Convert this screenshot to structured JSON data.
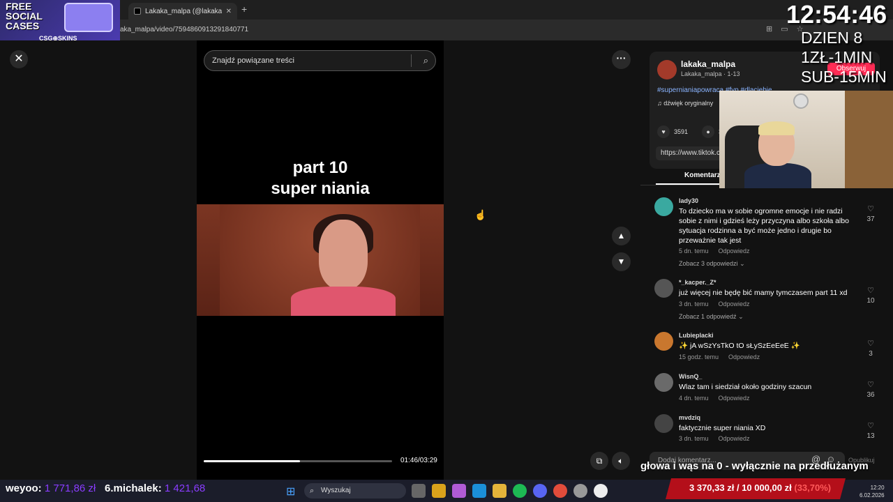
{
  "browser": {
    "tab_title": "Lakaka_malpa (@lakaka_ma",
    "new_tab": "+",
    "url": "aka_malpa/video/7594860913291840771"
  },
  "promo": {
    "line1": "FREE",
    "line2": "SOCIAL",
    "line3": "CASES",
    "brand": "CSG⊕SKINS"
  },
  "video": {
    "close": "✕",
    "search_placeholder": "Znajdź powiązane treści",
    "caption_line1": "part 10",
    "caption_line2": "super niania",
    "time": "01:46/03:29",
    "progress": 0.51
  },
  "post": {
    "username": "lakaka_malpa",
    "subline": "Lakaka_malpa · 1-13",
    "follow": "Obserwuj",
    "tags": "#supernianiapowraca #fyp #dlaciebie",
    "sound": "dźwięk oryginalny",
    "likes": "3591",
    "comments_count": "36",
    "link": "https://www.tiktok.c",
    "tab_comments": "Komentarze"
  },
  "comments": [
    {
      "user": "lady30",
      "text": "To dziecko ma w sobie ogromne emocje i nie radzi sobie z nimi i gdzieś leży przyczyna albo szkoła albo sytuacja rodzinna a być może jedno i drugie bo przeważnie tak jest",
      "time": "5 dn. temu",
      "reply": "Odpowiedz",
      "replies": "Zobacz 3 odpowiedzi",
      "likes": "37",
      "color": "#3aa9a0"
    },
    {
      "user": "*_kacper._Z*",
      "text": "już więcej nie będę bić mamy tymczasem part 11 xd",
      "time": "3 dn. temu",
      "reply": "Odpowiedz",
      "replies": "Zobacz 1 odpowiedź",
      "likes": "10",
      "color": "#555"
    },
    {
      "user": "Lubieplacki",
      "text": "✨ jA wSzYsTkO tO sŁySzEeEeE ✨",
      "time": "15 godz. temu",
      "reply": "Odpowiedz",
      "replies": "",
      "likes": "3",
      "color": "#c9772e"
    },
    {
      "user": "WisnQ_",
      "text": "Wlaz tam i siedział około godziny szacun",
      "time": "4 dn. temu",
      "reply": "Odpowiedz",
      "replies": "",
      "likes": "36",
      "color": "#6a6a6a"
    },
    {
      "user": "mvdziq",
      "text": "faktycznie super niania XD",
      "time": "3 dn. temu",
      "reply": "Odpowiedz",
      "replies": "",
      "likes": "13",
      "color": "#444"
    }
  ],
  "add_comment": {
    "placeholder": "Dodaj komentarz...",
    "post": "Opublikuj"
  },
  "overlay": {
    "clock": "12:54:46",
    "day": "DZIEN 8\n1ZŁ-1MIN\nSUB-15MIN",
    "ticker": "głowa i wąs na 0 - wyłącznie na przedłużanym"
  },
  "leaderboard": [
    {
      "name": "weyoo:",
      "amount": "1 771,86 zł"
    },
    {
      "name": "6.michalek:",
      "amount": "1 421,68"
    }
  ],
  "goal": {
    "current": "3 370,33 zł",
    "target": "10 000,00 zł",
    "percent": "(33,70%)"
  },
  "taskbar": {
    "search": "Wyszukaj",
    "time": "12:20",
    "date": "6.02.2026"
  }
}
